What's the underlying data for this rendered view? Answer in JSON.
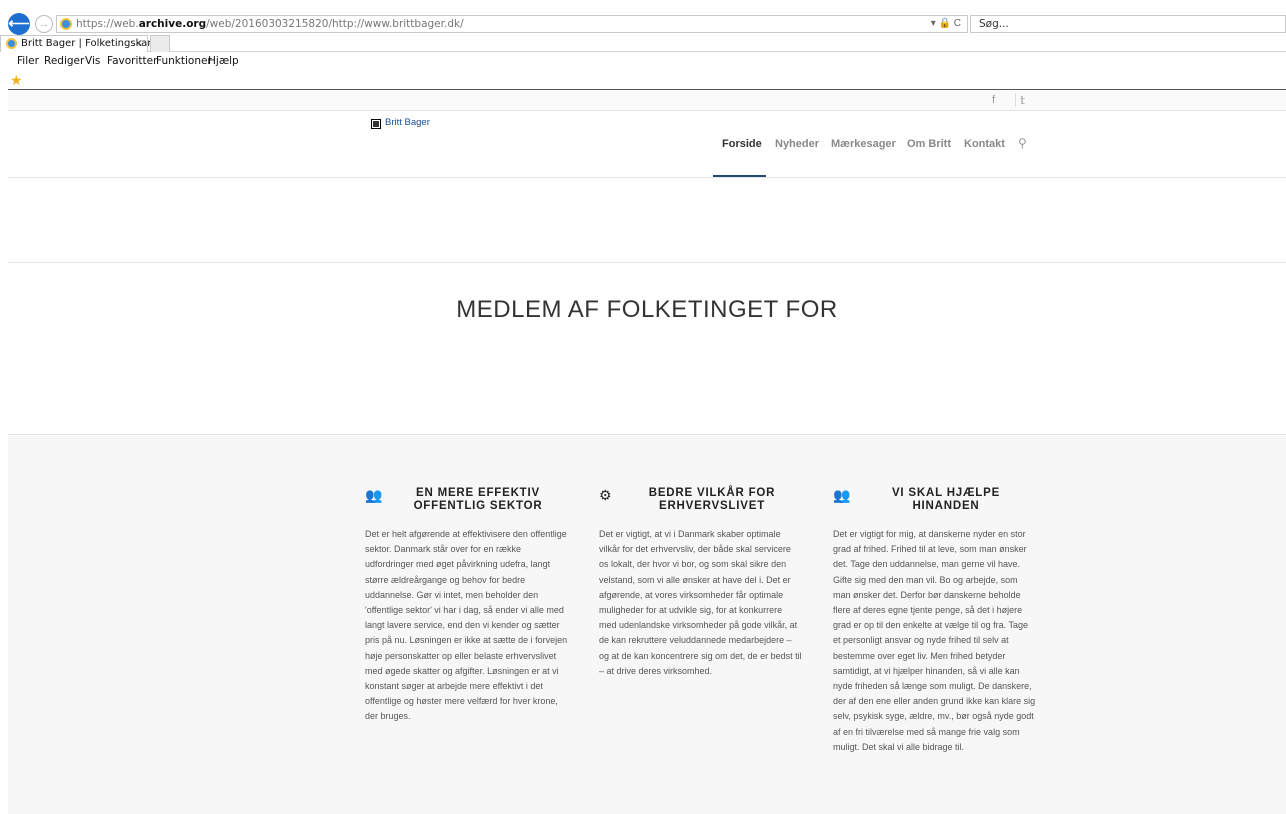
{
  "browser": {
    "url_prefix": "https://web.",
    "url_domain": "archive.org",
    "url_rest": "/web/20160303215820/http://www.brittbager.dk/",
    "url_tools": "▾ 🔒 C",
    "search_placeholder": "Søg...",
    "tab_title": "Britt Bager | Folketingskand...",
    "tab_close": "×",
    "menu": [
      "Filer",
      "Rediger",
      "Vis",
      "Favoritter",
      "Funktioner",
      "Hjælp"
    ]
  },
  "site": {
    "social": {
      "facebook": "f",
      "twitter": "𝕥"
    },
    "logo_alt": "Britt Bager",
    "nav": [
      "Forside",
      "Nyheder",
      "Mærkesager",
      "Om Britt",
      "Kontakt"
    ],
    "nav_search_icon": "⚲",
    "hero_title": "MEDLEM AF FOLKETINGET FOR",
    "columns": [
      {
        "icon": "users-icon",
        "glyph": "👥",
        "title_line1": "EN MERE EFFEKTIV",
        "title_line2": "OFFENTLIG SEKTOR",
        "text": "Det er helt afgørende at effektivisere den offentlige sektor. Danmark står over for en række udfordringer med øget påvirkning udefra, langt større ældreårgange og behov for bedre uddannelse. Gør vi intet, men beholder den 'offentlige sektor' vi har i dag, så ender vi alle med langt lavere service, end den vi kender og sætter pris på nu. Løsningen er ikke at sætte de i forvejen høje personskatter op eller belaste erhvervslivet med øgede skatter og afgifter. Løsningen er at vi konstant søger at arbejde mere effektivt i det offentlige og høster mere velfærd for hver krone, der bruges."
      },
      {
        "icon": "gear-icon",
        "glyph": "⚙",
        "title_line1": "BEDRE VILKÅR FOR",
        "title_line2": "ERHVERVSLIVET",
        "text": "Det er vigtigt, at vi i Danmark skaber optimale vilkår for det erhvervsliv, der både skal servicere os lokalt, der hvor vi bor, og som skal sikre den velstand, som vi alle ønsker at have del i. Det er afgørende, at vores virksomheder får optimale muligheder for at udvikle sig, for at konkurrere med udenlandske virksomheder på gode vilkår, at de kan rekruttere veluddannede medarbejdere – og at de kan koncentrere sig om det, de er bedst til – at drive deres virksomhed."
      },
      {
        "icon": "users-icon",
        "glyph": "👥",
        "title_line1": "VI SKAL HJÆLPE",
        "title_line2": "HINANDEN",
        "text": "Det er vigtigt for mig, at danskerne nyder en stor grad af frihed. Frihed til at leve, som man ønsker det. Tage den uddannelse, man gerne vil have. Gifte sig med den man vil. Bo og arbejde, som man ønsker det. Derfor bør danskerne beholde flere af deres egne tjente penge, så det i højere grad er op til den enkelte at vælge til og fra. Tage et personligt ansvar og nyde frihed til selv at bestemme over eget liv. Men frihed betyder samtidigt, at vi hjælper hinanden, så vi alle kan nyde friheden så længe som muligt. De danskere, der af den ene eller anden grund ikke kan klare sig selv, psykisk syge, ældre, mv., bør også nyde godt af en fri tilværelse med så mange frie valg som muligt. Det skal vi alle bidrage til."
      }
    ]
  }
}
